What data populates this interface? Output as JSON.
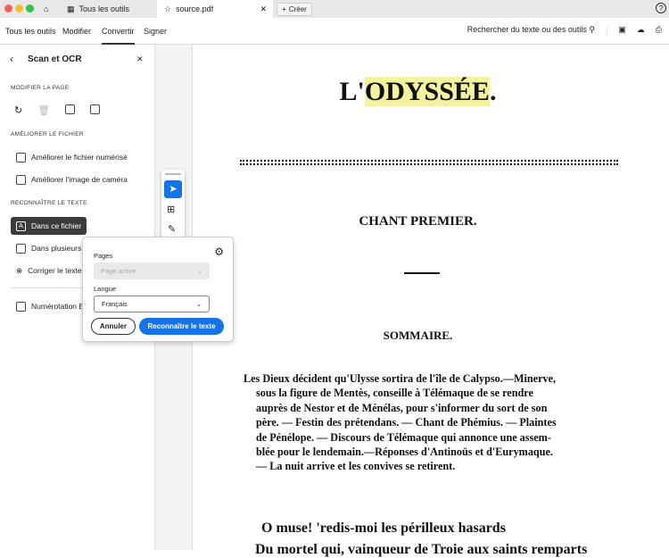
{
  "tabbar": {
    "home_tab": "home",
    "tools_tab": "Tous les outils",
    "doc_tab": "source.pdf",
    "create_label": "Créer"
  },
  "menu": {
    "tabs": [
      "Tous les outils",
      "Modifier",
      "Convertir",
      "Signer"
    ],
    "search": "Rechercher du texte ou des outils"
  },
  "panel": {
    "title": "Scan et OCR",
    "sec1": "MODIFIER LA PAGE",
    "sec2": "AMÉLIORER LE FICHIER",
    "sec3": "RECONNAÎTRE LE TEXTE",
    "items": [
      "Améliorer le fichier numérisé",
      "Améliorer l'image de caméra",
      "Dans ce fichier",
      "Dans plusieurs fichiers",
      "Corriger le texte",
      "Numérotation Bates"
    ]
  },
  "popup": {
    "pages_label": "Pages",
    "pages_value": "Page active",
    "lang_label": "Langue",
    "lang_value": "Français",
    "cancel": "Annuler",
    "ok": "Reconnaître le texte"
  },
  "doc": {
    "title_prefix": "L'",
    "title_highlight": "ODYSSÉE",
    "title_suffix": ".",
    "chant": "CHANT PREMIER.",
    "sommaire": "SOMMAIRE.",
    "para": [
      "Les Dieux décident qu'Ulysse sortira de l'île de Calypso.—Minerve,",
      "sous la figure de Mentès, conseille à Télémaque de se rendre",
      "auprès de Nestor et de Ménélas, pour s'informer du sort de son",
      "père. — Festin des prétendans. — Chant de Phémius. — Plaintes",
      "de Pénélope. — Discours de Télémaque qui annonce une assem-",
      "blée pour le lendemain.—Réponses d'Antinoüs et d'Eurymaque.",
      "— La nuit arrive et les convives se retirent."
    ],
    "verse": "O muse! 'redis-moi les périlleux hasards",
    "verse2": "Du mortel qui, vainqueur de Troie aux saints remparts"
  },
  "colors": {
    "accent": "#1473e6",
    "highlight": "#f4f1a0"
  }
}
